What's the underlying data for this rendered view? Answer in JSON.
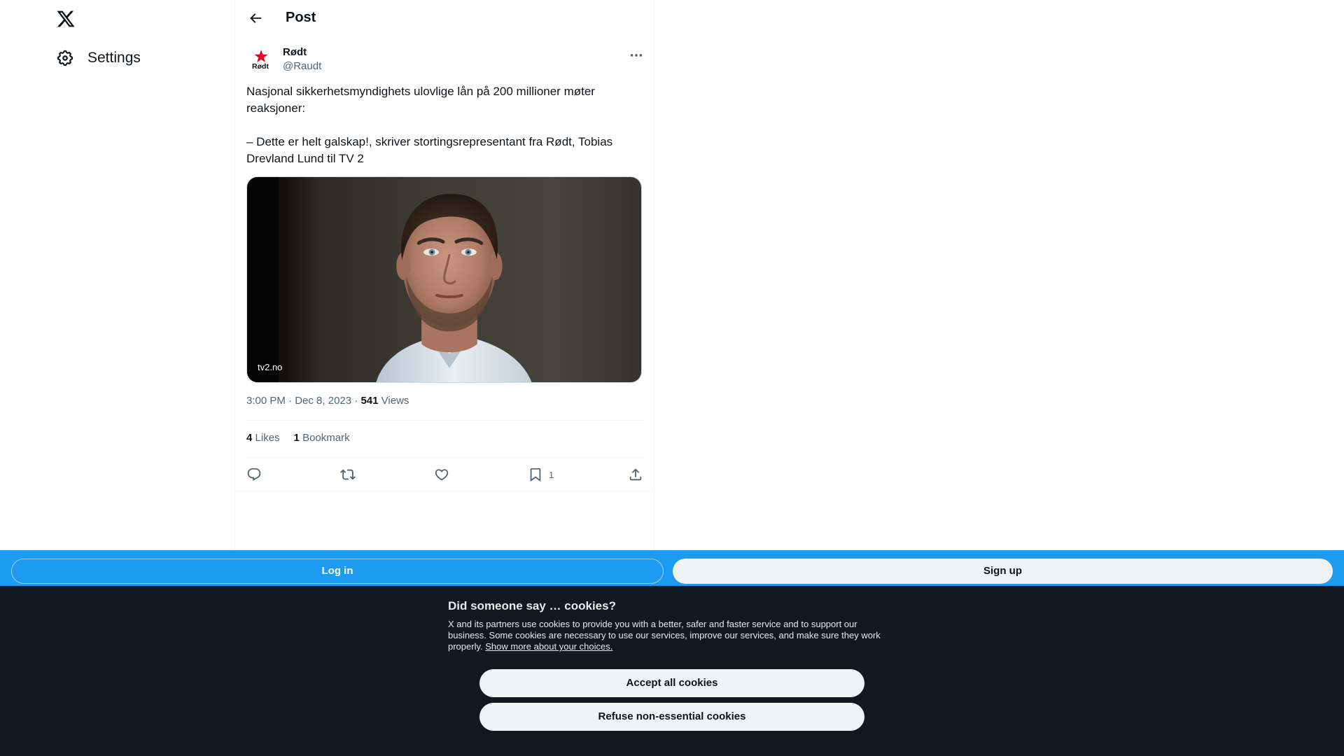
{
  "nav": {
    "logo_icon": "x-logo-icon",
    "settings_label": "Settings",
    "settings_icon": "gear-icon"
  },
  "header": {
    "back_icon": "arrow-left-icon",
    "title": "Post"
  },
  "post": {
    "author_name": "Rødt",
    "author_handle": "@Raudt",
    "avatar_text": "Rødt",
    "more_icon": "more-dots-icon",
    "text": "Nasjonal sikkerhetsmyndighets ulovlige lån på 200 millioner møter reaksjoner:\n\n– Dette er helt galskap!, skriver stortingsrepresentant fra Rødt, Tobias Drevland Lund til TV 2",
    "card_domain": "tv2.no",
    "time": "3:00 PM",
    "sep1": "·",
    "date": "Dec 8, 2023",
    "sep2": "·",
    "views_count": "541",
    "views_label": "Views",
    "likes_count": "4",
    "likes_label": "Likes",
    "bookmarks_count": "1",
    "bookmarks_label": "Bookmark",
    "bookmark_action_count": "1"
  },
  "loginbar": {
    "login_label": "Log in",
    "signup_label": "Sign up"
  },
  "cookie": {
    "title": "Did someone say … cookies?",
    "body": "X and its partners use cookies to provide you with a better, safer and faster service and to support our business. Some cookies are necessary to use our services, improve our services, and make sure they work properly. ",
    "link": "Show more about your choices.",
    "accept_label": "Accept all cookies",
    "refuse_label": "Refuse non-essential cookies"
  },
  "colors": {
    "brand_blue": "#1d9bf0",
    "banner_dark": "#111820",
    "text_primary": "#0f1419",
    "text_secondary": "#536471",
    "avatar_red": "#e4002b"
  }
}
